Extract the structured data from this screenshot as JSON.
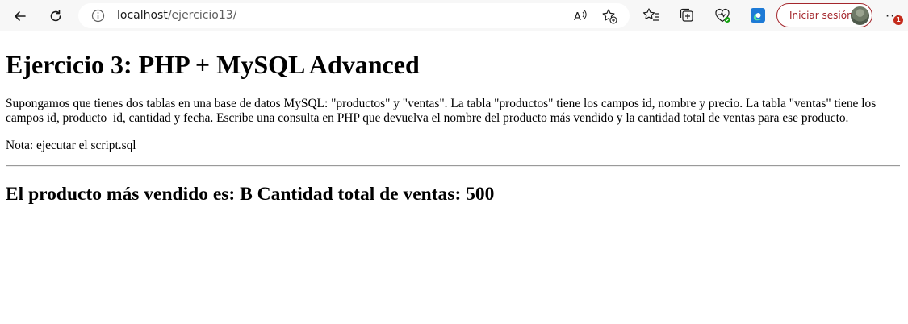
{
  "browser": {
    "url_host": "localhost",
    "url_path": "/ejercicio13/",
    "signin_label": "Iniciar sesión",
    "notification_count": "1",
    "icons": [
      "back-icon",
      "refresh-icon",
      "info-icon",
      "read-aloud-icon",
      "add-favorite-icon",
      "favorites-icon",
      "collections-icon",
      "browser-essentials-icon",
      "edge-icon",
      "avatar",
      "more-icon"
    ]
  },
  "page": {
    "title": "Ejercicio 3: PHP + MySQL Advanced",
    "description": "Supongamos que tienes dos tablas en una base de datos MySQL: \"productos\" y \"ventas\". La tabla \"productos\" tiene los campos id, nombre y precio. La tabla \"ventas\" tiene los campos id, producto_id, cantidad y fecha. Escribe una consulta en PHP que devuelva el nombre del producto más vendido y la cantidad total de ventas para ese producto.",
    "note": "Nota: ejecutar el script.sql",
    "result": "El producto más vendido es: B Cantidad total de ventas: 500"
  }
}
